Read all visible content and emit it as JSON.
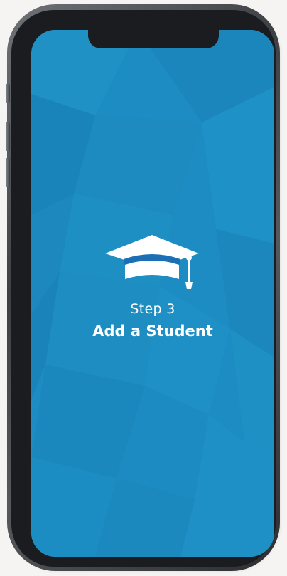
{
  "onboarding": {
    "step_label": "Step 3",
    "step_title": "Add a Student",
    "icon": "graduation-cap-icon"
  },
  "colors": {
    "screen_background": "#1c8cc2",
    "text": "#ffffff",
    "cap_band": "#1c6fb5"
  }
}
